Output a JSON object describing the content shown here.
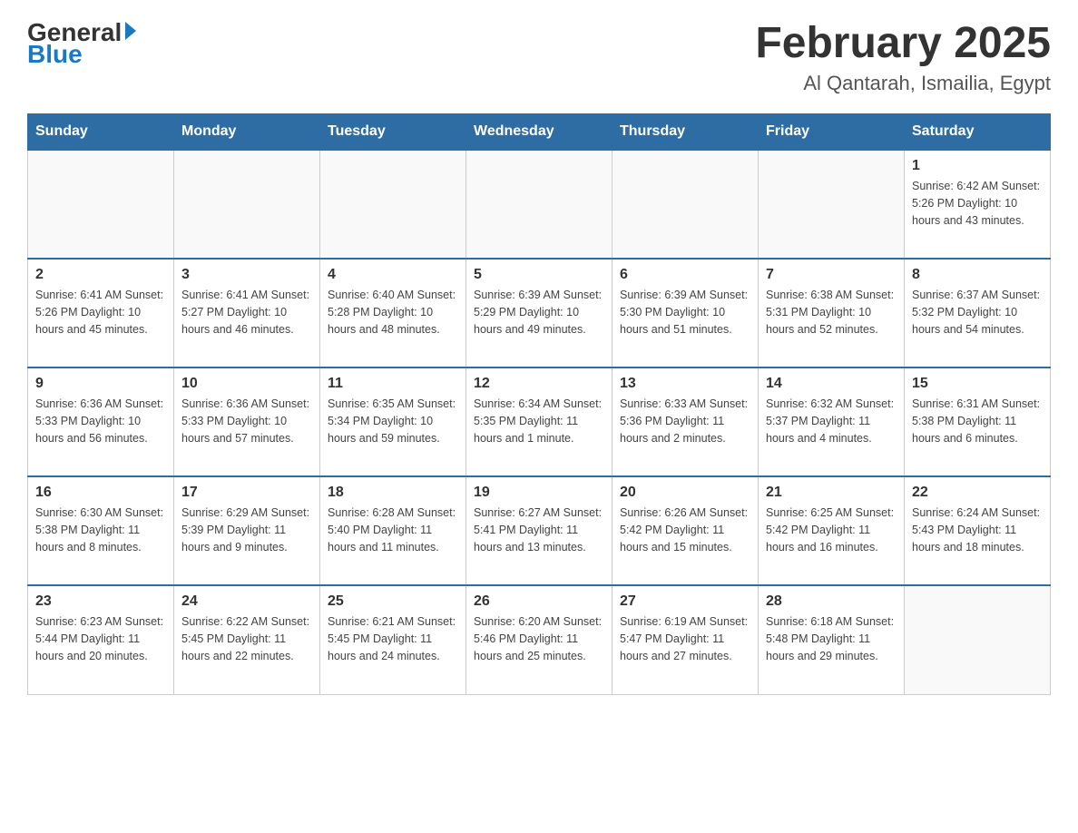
{
  "header": {
    "logo_general": "General",
    "logo_blue": "Blue",
    "title": "February 2025",
    "subtitle": "Al Qantarah, Ismailia, Egypt"
  },
  "days_of_week": [
    "Sunday",
    "Monday",
    "Tuesday",
    "Wednesday",
    "Thursday",
    "Friday",
    "Saturday"
  ],
  "weeks": [
    {
      "days": [
        {
          "number": "",
          "info": ""
        },
        {
          "number": "",
          "info": ""
        },
        {
          "number": "",
          "info": ""
        },
        {
          "number": "",
          "info": ""
        },
        {
          "number": "",
          "info": ""
        },
        {
          "number": "",
          "info": ""
        },
        {
          "number": "1",
          "info": "Sunrise: 6:42 AM\nSunset: 5:26 PM\nDaylight: 10 hours and 43 minutes."
        }
      ]
    },
    {
      "days": [
        {
          "number": "2",
          "info": "Sunrise: 6:41 AM\nSunset: 5:26 PM\nDaylight: 10 hours and 45 minutes."
        },
        {
          "number": "3",
          "info": "Sunrise: 6:41 AM\nSunset: 5:27 PM\nDaylight: 10 hours and 46 minutes."
        },
        {
          "number": "4",
          "info": "Sunrise: 6:40 AM\nSunset: 5:28 PM\nDaylight: 10 hours and 48 minutes."
        },
        {
          "number": "5",
          "info": "Sunrise: 6:39 AM\nSunset: 5:29 PM\nDaylight: 10 hours and 49 minutes."
        },
        {
          "number": "6",
          "info": "Sunrise: 6:39 AM\nSunset: 5:30 PM\nDaylight: 10 hours and 51 minutes."
        },
        {
          "number": "7",
          "info": "Sunrise: 6:38 AM\nSunset: 5:31 PM\nDaylight: 10 hours and 52 minutes."
        },
        {
          "number": "8",
          "info": "Sunrise: 6:37 AM\nSunset: 5:32 PM\nDaylight: 10 hours and 54 minutes."
        }
      ]
    },
    {
      "days": [
        {
          "number": "9",
          "info": "Sunrise: 6:36 AM\nSunset: 5:33 PM\nDaylight: 10 hours and 56 minutes."
        },
        {
          "number": "10",
          "info": "Sunrise: 6:36 AM\nSunset: 5:33 PM\nDaylight: 10 hours and 57 minutes."
        },
        {
          "number": "11",
          "info": "Sunrise: 6:35 AM\nSunset: 5:34 PM\nDaylight: 10 hours and 59 minutes."
        },
        {
          "number": "12",
          "info": "Sunrise: 6:34 AM\nSunset: 5:35 PM\nDaylight: 11 hours and 1 minute."
        },
        {
          "number": "13",
          "info": "Sunrise: 6:33 AM\nSunset: 5:36 PM\nDaylight: 11 hours and 2 minutes."
        },
        {
          "number": "14",
          "info": "Sunrise: 6:32 AM\nSunset: 5:37 PM\nDaylight: 11 hours and 4 minutes."
        },
        {
          "number": "15",
          "info": "Sunrise: 6:31 AM\nSunset: 5:38 PM\nDaylight: 11 hours and 6 minutes."
        }
      ]
    },
    {
      "days": [
        {
          "number": "16",
          "info": "Sunrise: 6:30 AM\nSunset: 5:38 PM\nDaylight: 11 hours and 8 minutes."
        },
        {
          "number": "17",
          "info": "Sunrise: 6:29 AM\nSunset: 5:39 PM\nDaylight: 11 hours and 9 minutes."
        },
        {
          "number": "18",
          "info": "Sunrise: 6:28 AM\nSunset: 5:40 PM\nDaylight: 11 hours and 11 minutes."
        },
        {
          "number": "19",
          "info": "Sunrise: 6:27 AM\nSunset: 5:41 PM\nDaylight: 11 hours and 13 minutes."
        },
        {
          "number": "20",
          "info": "Sunrise: 6:26 AM\nSunset: 5:42 PM\nDaylight: 11 hours and 15 minutes."
        },
        {
          "number": "21",
          "info": "Sunrise: 6:25 AM\nSunset: 5:42 PM\nDaylight: 11 hours and 16 minutes."
        },
        {
          "number": "22",
          "info": "Sunrise: 6:24 AM\nSunset: 5:43 PM\nDaylight: 11 hours and 18 minutes."
        }
      ]
    },
    {
      "days": [
        {
          "number": "23",
          "info": "Sunrise: 6:23 AM\nSunset: 5:44 PM\nDaylight: 11 hours and 20 minutes."
        },
        {
          "number": "24",
          "info": "Sunrise: 6:22 AM\nSunset: 5:45 PM\nDaylight: 11 hours and 22 minutes."
        },
        {
          "number": "25",
          "info": "Sunrise: 6:21 AM\nSunset: 5:45 PM\nDaylight: 11 hours and 24 minutes."
        },
        {
          "number": "26",
          "info": "Sunrise: 6:20 AM\nSunset: 5:46 PM\nDaylight: 11 hours and 25 minutes."
        },
        {
          "number": "27",
          "info": "Sunrise: 6:19 AM\nSunset: 5:47 PM\nDaylight: 11 hours and 27 minutes."
        },
        {
          "number": "28",
          "info": "Sunrise: 6:18 AM\nSunset: 5:48 PM\nDaylight: 11 hours and 29 minutes."
        },
        {
          "number": "",
          "info": ""
        }
      ]
    }
  ]
}
